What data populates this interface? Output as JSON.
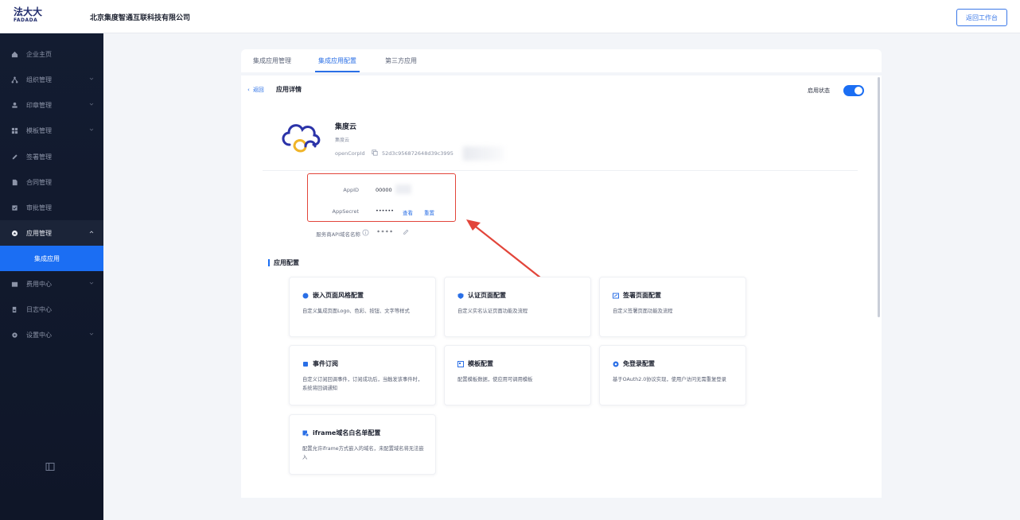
{
  "header": {
    "logo_title": "法大大",
    "logo_sub": "FADADA",
    "company": "北京集度智通互联科技有限公司",
    "back_button": "返回工作台"
  },
  "sidebar": {
    "items": [
      {
        "label": "企业主页",
        "icon": "home-icon",
        "state": "normal",
        "chevron": false
      },
      {
        "label": "组织管理",
        "icon": "org-icon",
        "state": "normal",
        "chevron": true
      },
      {
        "label": "印章管理",
        "icon": "seal-icon",
        "state": "normal",
        "chevron": true
      },
      {
        "label": "模板管理",
        "icon": "grid-icon",
        "state": "normal",
        "chevron": true
      },
      {
        "label": "签署管理",
        "icon": "pen-icon",
        "state": "normal",
        "chevron": false
      },
      {
        "label": "合同管理",
        "icon": "document-icon",
        "state": "normal",
        "chevron": false
      },
      {
        "label": "审批管理",
        "icon": "approval-icon",
        "state": "normal",
        "chevron": false
      },
      {
        "label": "应用管理",
        "icon": "app-icon",
        "state": "open",
        "chevron": true
      },
      {
        "label": "集成应用",
        "icon": "",
        "state": "active",
        "chevron": false
      },
      {
        "label": "费用中心",
        "icon": "wallet-icon",
        "state": "normal",
        "chevron": true
      },
      {
        "label": "日志中心",
        "icon": "log-icon",
        "state": "normal",
        "chevron": false
      },
      {
        "label": "设置中心",
        "icon": "gear-icon",
        "state": "normal",
        "chevron": true
      }
    ],
    "collapse_icon": "collapse-icon"
  },
  "tabs": [
    {
      "label": "集成应用管理",
      "active": false
    },
    {
      "label": "集成应用配置",
      "active": true
    },
    {
      "label": "第三方应用",
      "active": false
    }
  ],
  "detail": {
    "back": "返回",
    "title": "应用详情",
    "status_label": "启用状态",
    "status_on": true
  },
  "app": {
    "name": "集度云",
    "type": "集度云",
    "corp_label": "openCorpId",
    "corp_value": "52d3c956872648d39c3995",
    "fields": [
      {
        "label": "AppID",
        "value": "00000"
      },
      {
        "label": "AppSecret",
        "value": "••••••"
      }
    ],
    "view_link": "查看",
    "reset_link": "重置",
    "api_label": "服务商API域名名称",
    "api_value": "* * * *"
  },
  "config": {
    "section_title": "应用配置",
    "cards": [
      {
        "title": "嵌入页面风格配置",
        "icon": "palette-icon",
        "desc": "自定义集成页面Logo、色彩、按钮、文字等样式"
      },
      {
        "title": "认证页面配置",
        "icon": "shield-icon",
        "desc": "自定义实名认证页面功能及流程"
      },
      {
        "title": "签署页面配置",
        "icon": "sign-icon",
        "desc": "自定义签署页面功能及流程"
      },
      {
        "title": "事件订阅",
        "icon": "bell-icon",
        "desc": "自定义订阅回调事件，订阅成功后，当触发该事件时，系统将回调通知"
      },
      {
        "title": "模板配置",
        "icon": "template-icon",
        "desc": "配置模板数据，使应用可调用模板"
      },
      {
        "title": "免登录配置",
        "icon": "key-icon",
        "desc": "基于OAuth2.0协议实现，使用户访问无需重复登录"
      },
      {
        "title": "iframe域名白名单配置",
        "icon": "iframe-icon",
        "desc": "配置允许iframe方式嵌入的域名，未配置域名将无法嵌入"
      }
    ]
  },
  "colors": {
    "accent": "#1b6ef3",
    "sidebar_bg": "#131c31",
    "highlight_red": "#e2453a"
  }
}
